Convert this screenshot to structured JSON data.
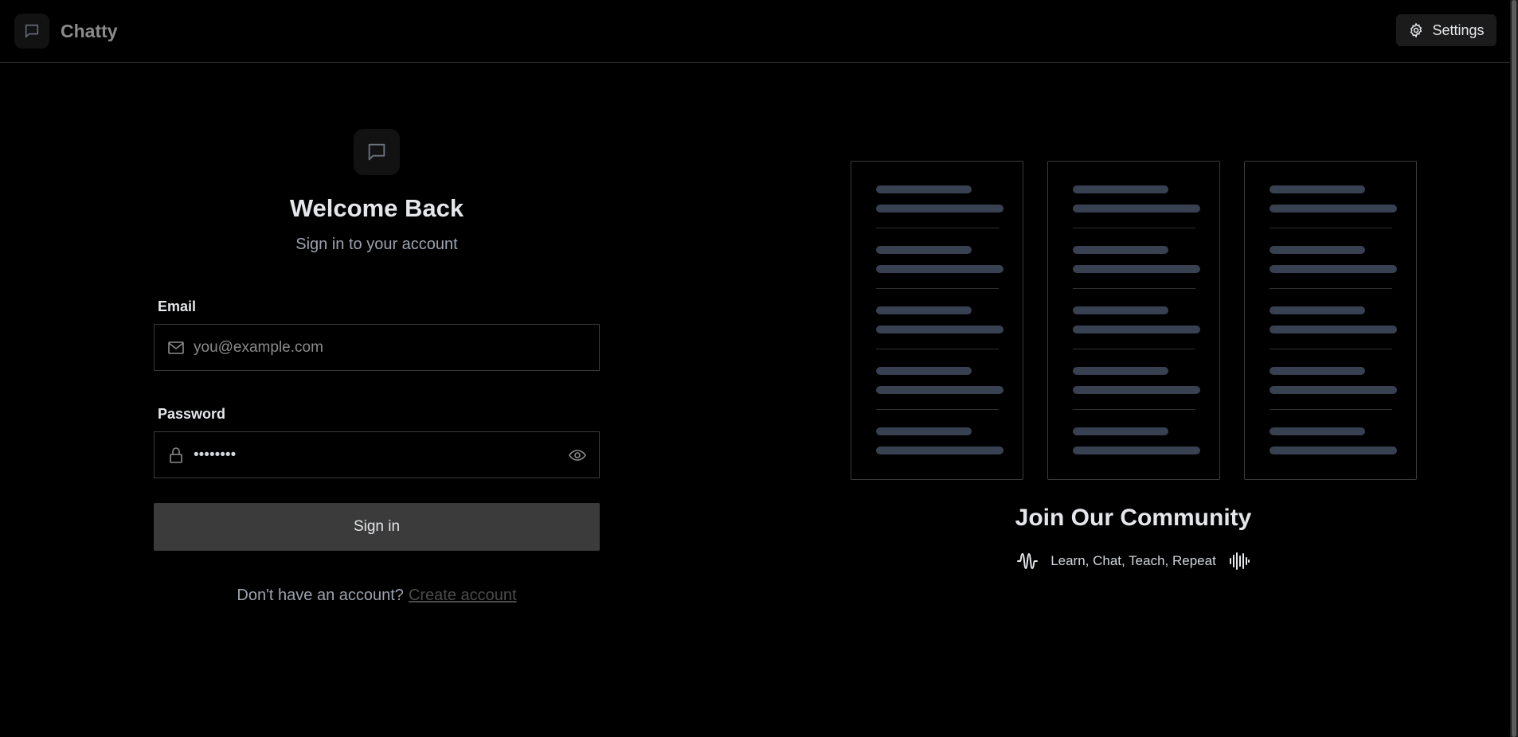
{
  "header": {
    "brand_name": "Chatty",
    "settings_label": "Settings"
  },
  "login": {
    "title": "Welcome Back",
    "subtitle": "Sign in to your account",
    "email_label": "Email",
    "email_placeholder": "you@example.com",
    "email_value": "",
    "password_label": "Password",
    "password_value": "••••••••",
    "submit_label": "Sign in",
    "signup_prompt": "Don't have an account?",
    "signup_link": "Create account"
  },
  "community": {
    "title": "Join Our Community",
    "tagline": "Learn, Chat, Teach, Repeat",
    "cards": [
      {
        "items": 5
      },
      {
        "items": 5
      },
      {
        "items": 5
      }
    ]
  },
  "icons": {
    "brand": "message-square-icon",
    "settings": "gear-icon",
    "email": "mail-icon",
    "password": "lock-icon",
    "toggle_password": "eye-icon",
    "tagline_left": "wave-icon",
    "tagline_right": "audio-lines-icon"
  },
  "colors": {
    "background": "#000000",
    "button": "#3b3b3b",
    "skeleton": "#374151",
    "border": "#3a3a3a"
  }
}
